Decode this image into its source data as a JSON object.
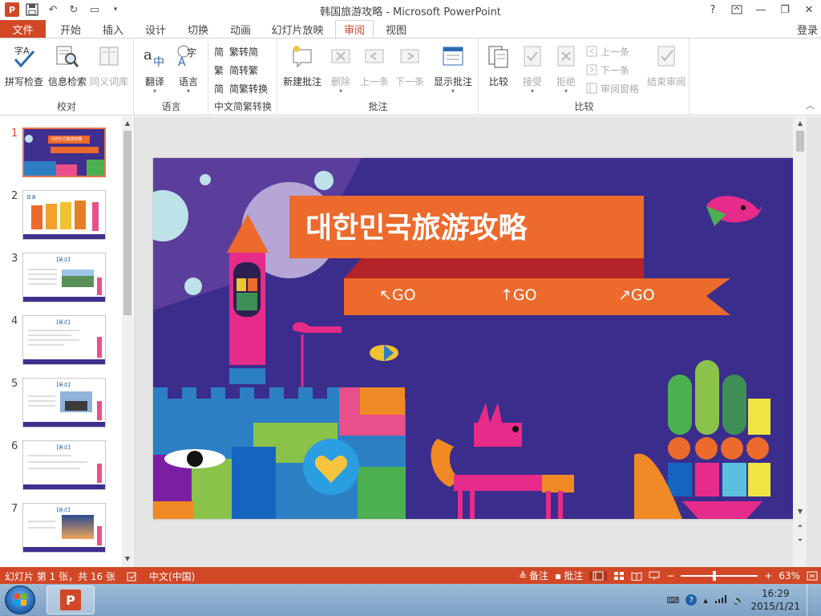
{
  "app": {
    "title": "韩国旅游攻略 - Microsoft PowerPoint",
    "login": "登录",
    "brand_color": "#d24726"
  },
  "window_controls": [
    "?",
    "□",
    "—",
    "❐",
    "✕"
  ],
  "tabs": [
    {
      "label": "文件"
    },
    {
      "label": "开始"
    },
    {
      "label": "插入"
    },
    {
      "label": "设计"
    },
    {
      "label": "切换"
    },
    {
      "label": "动画"
    },
    {
      "label": "幻灯片放映"
    },
    {
      "label": "审阅",
      "active": true
    },
    {
      "label": "视图"
    }
  ],
  "ribbon": {
    "groups": {
      "proofing": {
        "label": "校对",
        "buttons": [
          "拼写检查",
          "信息检索",
          "同义词库"
        ]
      },
      "language": {
        "label": "语言",
        "buttons": [
          "翻译",
          "语言"
        ]
      },
      "chinese": {
        "label": "中文简繁转换",
        "buttons": [
          "繁转简",
          "简转繁",
          "简繁转换"
        ]
      },
      "comments": {
        "label": "批注",
        "buttons": [
          "新建批注",
          "删除",
          "上一条",
          "下一条",
          "显示批注"
        ]
      },
      "compare": {
        "label": "比较",
        "buttons": [
          "比较",
          "接受",
          "拒绝",
          "上一条",
          "下一条",
          "审阅窗格",
          "结束审阅"
        ]
      }
    }
  },
  "thumbnails": [
    {
      "num": "1",
      "active": true,
      "label": "대한민국旅游攻略"
    },
    {
      "num": "2",
      "label": "目录"
    },
    {
      "num": "3",
      "label": "【景点】"
    },
    {
      "num": "4",
      "label": "【景点】"
    },
    {
      "num": "5",
      "label": "【景点】"
    },
    {
      "num": "6",
      "label": "【景点】"
    },
    {
      "num": "7",
      "label": "【景点】"
    }
  ],
  "slide": {
    "title": "대한민국旅游攻略",
    "go_buttons": [
      "↖GO",
      "↑GO",
      "↗GO"
    ]
  },
  "statusbar": {
    "slide_info": "幻灯片 第 1 张，共 16 张",
    "language": "中文(中国)",
    "notes": "备注",
    "comments": "批注",
    "zoom": "63%"
  },
  "taskbar": {
    "time": "16:29",
    "date": "2015/1/21"
  }
}
